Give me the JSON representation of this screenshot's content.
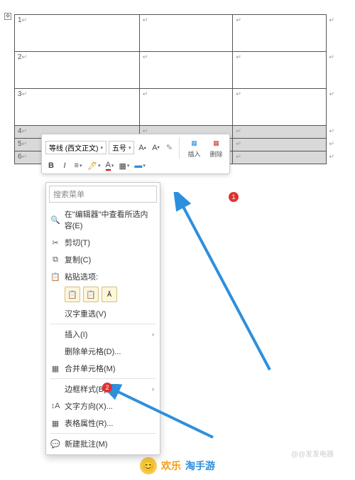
{
  "table": {
    "row_labels": [
      "1",
      "2",
      "3",
      "4",
      "5",
      "6"
    ],
    "selected_rows": [
      4,
      5,
      6
    ],
    "columns": 3
  },
  "mini_toolbar": {
    "font_name": "等线 (西文正文)",
    "font_size": "五号",
    "insert_label": "插入",
    "delete_label": "删除"
  },
  "context_menu": {
    "search_placeholder": "搜索菜单",
    "items": {
      "search_in_editor": "在\"编辑器\"中查看所选内容(E)",
      "cut": "剪切(T)",
      "copy": "复制(C)",
      "paste_options_label": "粘贴选项:",
      "hanzi_reselect": "汉字重选(V)",
      "insert": "插入(I)",
      "delete_cells": "删除单元格(D)...",
      "merge_cells": "合并单元格(M)",
      "border_styles": "边框样式(B)",
      "text_direction": "文字方向(X)...",
      "table_properties": "表格属性(R)...",
      "new_comment": "新建批注(M)"
    }
  },
  "callouts": {
    "badge1": "1",
    "badge2": "2"
  },
  "footer": {
    "text1": "欢乐",
    "text2": "淘手游"
  },
  "watermark": "@@发发电器"
}
